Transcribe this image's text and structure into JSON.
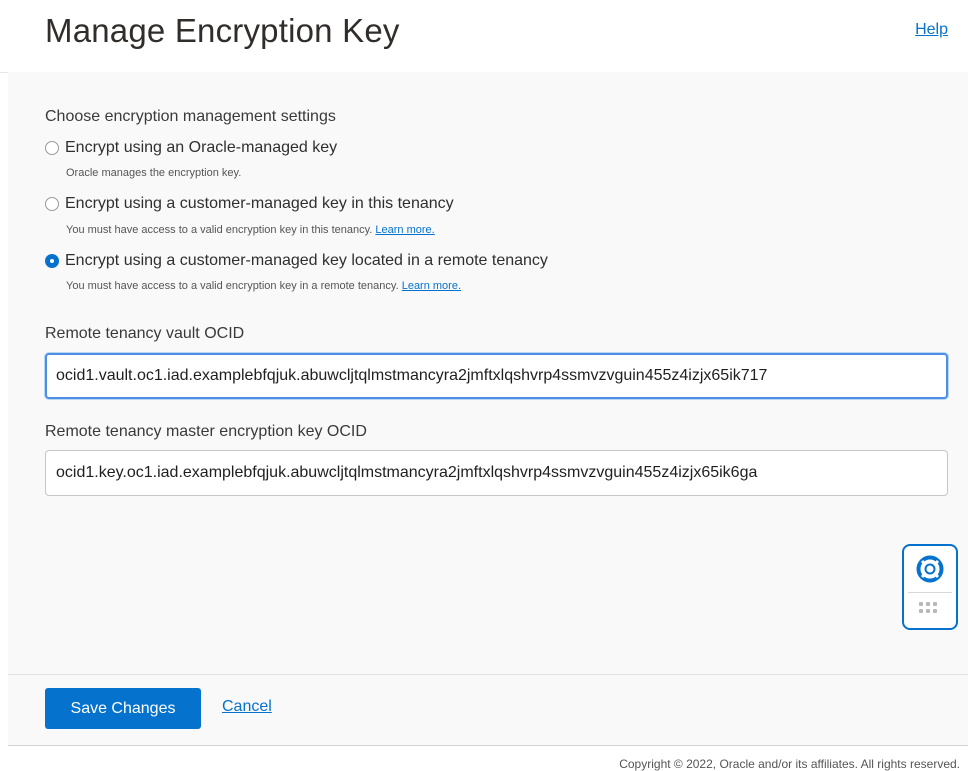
{
  "header": {
    "title": "Manage Encryption Key",
    "help_label": "Help"
  },
  "encryption": {
    "section_label": "Choose encryption management settings",
    "options": [
      {
        "label": "Encrypt using an Oracle-managed key",
        "help": "Oracle manages the encryption key.",
        "selected": false
      },
      {
        "label": "Encrypt using a customer-managed key in this tenancy",
        "help": "You must have access to a valid encryption key in this tenancy.",
        "link": "Learn more.",
        "selected": false
      },
      {
        "label": "Encrypt using a customer-managed key located in a remote tenancy",
        "help": "You must have access to a valid encryption key in a remote tenancy.",
        "link": "Learn more.",
        "selected": true
      }
    ]
  },
  "fields": {
    "vault": {
      "label": "Remote tenancy vault OCID",
      "value": "ocid1.vault.oc1.iad.examplebfqjuk.abuwcljtqlmstmancyra2jmftxlqshvrp4ssmvzvguin455z4izjx65ik717"
    },
    "key": {
      "label": "Remote tenancy master encryption key OCID",
      "value": "ocid1.key.oc1.iad.examplebfqjuk.abuwcljtqlmstmancyra2jmftxlqshvrp4ssmvzvguin455z4izjx65ik6ga"
    }
  },
  "support_widget": {
    "icon": "lifebuoy-icon",
    "handle_icon": "drag-handle-icon"
  },
  "actions": {
    "save_label": "Save Changes",
    "cancel_label": "Cancel"
  },
  "footer": {
    "copyright": "Copyright © 2022, Oracle and/or its affiliates. All rights reserved."
  },
  "colors": {
    "accent": "#0572ce",
    "focus_ring": "#4d90e3",
    "panel_bg": "#f9f9f9"
  }
}
